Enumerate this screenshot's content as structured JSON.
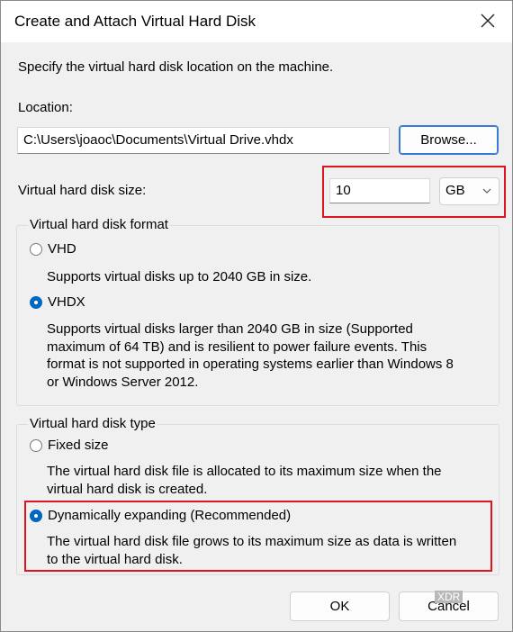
{
  "window": {
    "title": "Create and Attach Virtual Hard Disk"
  },
  "intro": "Specify the virtual hard disk location on the machine.",
  "location": {
    "label": "Location:",
    "value": "C:\\Users\\joaoc\\Documents\\Virtual Drive.vhdx",
    "browse_label": "Browse..."
  },
  "size": {
    "label": "Virtual hard disk size:",
    "value": "10",
    "unit": "GB"
  },
  "format_group": {
    "label": "Virtual hard disk format",
    "options": [
      {
        "label": "VHD",
        "selected": false,
        "desc_lines": [
          "Supports virtual disks up to 2040 GB in size."
        ]
      },
      {
        "label": "VHDX",
        "selected": true,
        "desc_lines": [
          "Supports virtual disks larger than 2040 GB in size (Supported",
          "maximum of 64 TB) and is resilient to power failure events. This",
          "format is not supported in operating systems earlier than Windows 8",
          "or Windows Server 2012."
        ]
      }
    ]
  },
  "type_group": {
    "label": "Virtual hard disk type",
    "options": [
      {
        "label": "Fixed size",
        "selected": false,
        "desc_lines": [
          "The virtual hard disk file is allocated to its maximum size when the",
          "virtual hard disk is created."
        ]
      },
      {
        "label": "Dynamically expanding (Recommended)",
        "selected": true,
        "desc_lines": [
          "The virtual hard disk file grows to its maximum size as data is written",
          "to the virtual hard disk."
        ]
      }
    ]
  },
  "buttons": {
    "ok": "OK",
    "cancel": "Cancel"
  },
  "watermark": "XDR",
  "colors": {
    "highlight": "#e0141e",
    "accent": "#0067c0"
  },
  "icons": {
    "close": "close-icon",
    "dropdown": "chevron-down-icon"
  }
}
